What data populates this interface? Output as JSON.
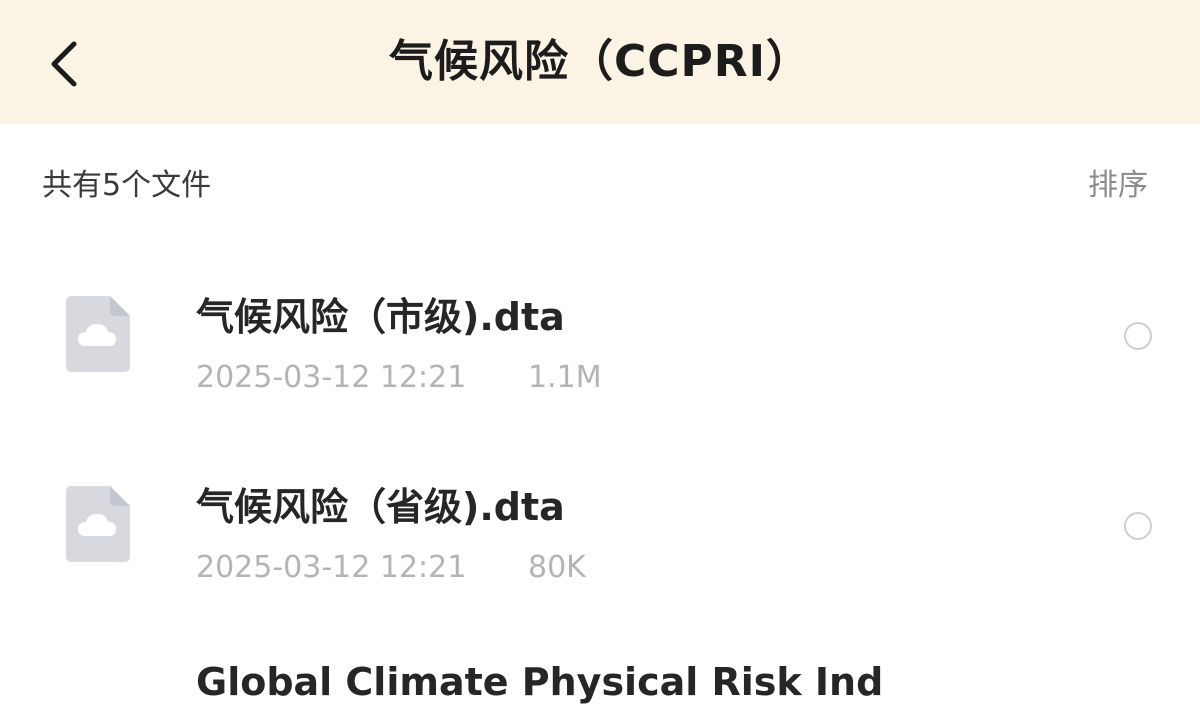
{
  "header": {
    "title": "气候风险（CCPRI）",
    "back_icon": "chevron-left-icon",
    "background": "#fbf3e3"
  },
  "toolbar": {
    "file_count": "共有5个文件",
    "sort_label": "排序"
  },
  "files": [
    {
      "name": "气候风险（市级).dta",
      "date": "2025-03-12 12:21",
      "size": "1.1M",
      "icon": "cloud-file-icon",
      "selected": false
    },
    {
      "name": "气候风险（省级).dta",
      "date": "2025-03-12 12:21",
      "size": "80K",
      "icon": "cloud-file-icon",
      "selected": false
    },
    {
      "name": "Global Climate Physical Risk Ind",
      "icon": "cloud-file-icon"
    }
  ]
}
